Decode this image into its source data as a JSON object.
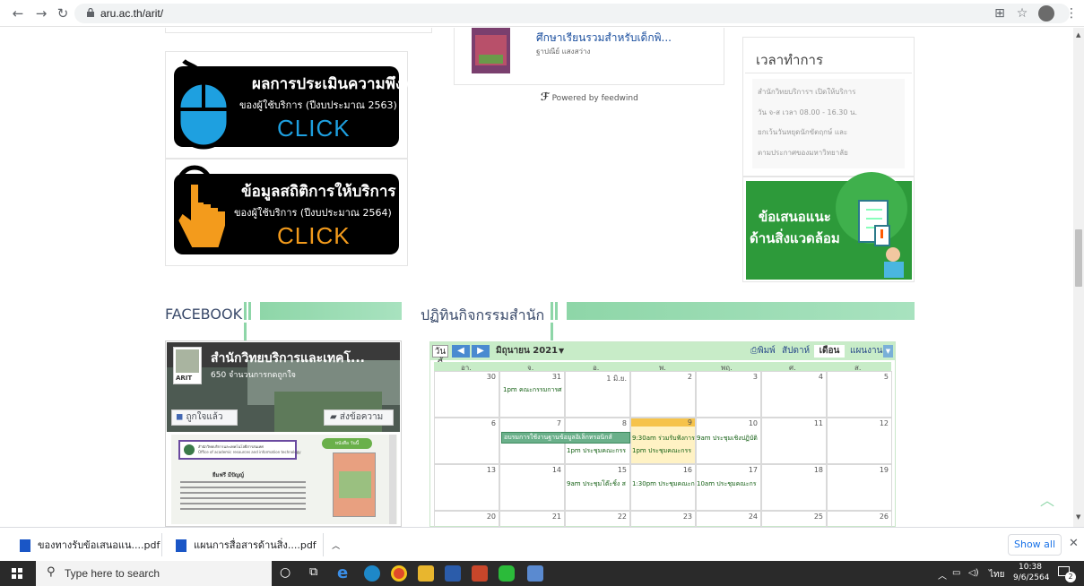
{
  "browser": {
    "url": "aru.ac.th/arit/"
  },
  "feed": {
    "item_title": "ศึกษาเรียนรวมสำหรับเด็กพิ...",
    "item_author": "ฐาปณีย์ แสงสว่าง",
    "powered": "Powered by feedwind"
  },
  "banner1": {
    "title": "ผลการประเมินความพึงพอใจ",
    "sub": "ของผู้ใช้บริการ (ปีงบประมาณ 2563)",
    "click": "CLICK"
  },
  "banner2": {
    "title": "ข้อมูลสถิติการให้บริการ",
    "sub": "ของผู้ใช้บริการ (ปีงบประมาณ 2564)",
    "click": "CLICK"
  },
  "hours": {
    "title": "เวลาทำการ",
    "lines": [
      "สำนักวิทยบริการฯ เปิดให้บริการ",
      "วัน จ-ส เวลา 08.00 - 16.30 น.",
      "ยกเว้นวันหยุดนักขัตฤกษ์ และ",
      "ตามประกาศของมหาวิทยาลัย"
    ]
  },
  "env_banner": {
    "line1": "ข้อเสนอแนะ",
    "line2": "ด้านสิ่งแวดล้อม"
  },
  "sections": {
    "facebook": "FACEBOOK",
    "calendar": "ปฏิทินกิจกรรมสำนัก"
  },
  "facebook": {
    "page_name": "สำนักวิทยบริการและเทคโ...",
    "likes": "650 จำนวนการกดถูกใจ",
    "liked_btn": "ถูกใจแล้ว",
    "message_btn": "ส่งข้อความ",
    "logo_text": "ARIT",
    "post_label": "สำนักวิทยบริการและเทคโนโลยีสารสนเทศ",
    "post_sub": "Office of academic resources and information technology",
    "book_tag": "หนังสือ วันนี้",
    "post_heading": "ยืมฟรี มีปัญญ์"
  },
  "calendar": {
    "today_btn": "วันนี้",
    "month": "มิถุนายน 2021",
    "print": "พิมพ์",
    "views": [
      "สัปดาห์",
      "เดือน",
      "แผนงาน"
    ],
    "days": [
      "อา.",
      "จ.",
      "อ.",
      "พ.",
      "พฤ.",
      "ศ.",
      "ส."
    ],
    "weeks": [
      [
        "30",
        "31",
        "1 มิ.ย.",
        "2",
        "3",
        "4",
        "5"
      ],
      [
        "6",
        "7",
        "8",
        "9",
        "10",
        "11",
        "12"
      ],
      [
        "13",
        "14",
        "15",
        "16",
        "17",
        "18",
        "19"
      ],
      [
        "20",
        "21",
        "22",
        "23",
        "24",
        "25",
        "26"
      ]
    ],
    "events": {
      "e1": "1pm คณะกรรมการศ",
      "e2": "อบรมการใช้งานฐานข้อมูลอิเล็กทรอนิกส์",
      "e3": "9:30am ร่วมรับฟังการ",
      "e4": "9am ประชุมเชิงปฏิบัติ",
      "e5": "1pm ประชุมคณะกรร",
      "e6": "1pm ประชุมคณะกรร",
      "e7": "9am ประชุมโต๊ะชิ้ง ส",
      "e8": "1:30pm ประชุมคณะก",
      "e9": "10am ประชุมคณะกร"
    }
  },
  "downloads": {
    "file1": "ของทางรับข้อเสนอแน....pdf",
    "file2": "แผนการสื่อสารด้านสิ่ง....pdf",
    "show_all": "Show all"
  },
  "taskbar": {
    "search_placeholder": "Type here to search",
    "lang": "ไทย",
    "time": "10:38",
    "date": "9/6/2564",
    "notif_count": "2"
  },
  "colors": {
    "accent_green": "#8ed6a8",
    "click_blue": "#1ea0e0",
    "click_orange": "#f39b1c",
    "today_cell": "#fff2c4"
  }
}
